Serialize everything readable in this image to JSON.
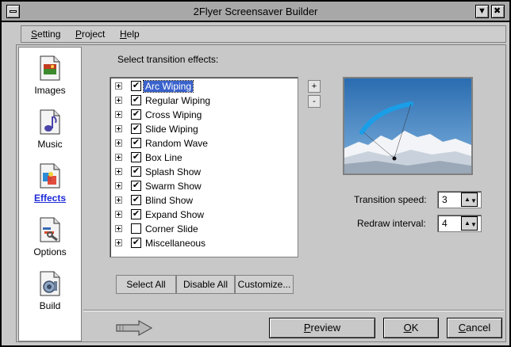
{
  "window": {
    "title": "2Flyer Screensaver Builder"
  },
  "menu": {
    "items": [
      {
        "label": "Setting",
        "accel": "S",
        "rest": "etting"
      },
      {
        "label": "Project",
        "accel": "P",
        "rest": "roject"
      },
      {
        "label": "Help",
        "accel": "H",
        "rest": "elp"
      }
    ]
  },
  "sidebar": {
    "items": [
      {
        "label": "Images",
        "icon": "images-icon",
        "active": false
      },
      {
        "label": "Music",
        "icon": "music-icon",
        "active": false
      },
      {
        "label": "Effects",
        "icon": "effects-icon",
        "active": true
      },
      {
        "label": "Options",
        "icon": "options-icon",
        "active": false
      },
      {
        "label": "Build",
        "icon": "build-icon",
        "active": false
      }
    ]
  },
  "effects": {
    "section_label": "Select transition effects:",
    "items": [
      {
        "label": "Arc Wiping",
        "checked": true,
        "selected": true
      },
      {
        "label": "Regular Wiping",
        "checked": true,
        "selected": false
      },
      {
        "label": "Cross Wiping",
        "checked": true,
        "selected": false
      },
      {
        "label": "Slide Wiping",
        "checked": true,
        "selected": false
      },
      {
        "label": "Random Wave",
        "checked": true,
        "selected": false
      },
      {
        "label": "Box Line",
        "checked": true,
        "selected": false
      },
      {
        "label": "Splash Show",
        "checked": true,
        "selected": false
      },
      {
        "label": "Swarm Show",
        "checked": true,
        "selected": false
      },
      {
        "label": "Blind Show",
        "checked": true,
        "selected": false
      },
      {
        "label": "Expand Show",
        "checked": true,
        "selected": false
      },
      {
        "label": "Corner Slide",
        "checked": false,
        "selected": false
      },
      {
        "label": "Miscellaneous",
        "checked": true,
        "selected": false
      }
    ],
    "plus_label": "+",
    "minus_label": "-",
    "buttons": {
      "select_all": "Select All",
      "disable_all": "Disable All",
      "customize": "Customize..."
    }
  },
  "settings": {
    "transition_speed_label": "Transition speed:",
    "transition_speed_value": "3",
    "redraw_interval_label": "Redraw interval:",
    "redraw_interval_value": "4"
  },
  "footer": {
    "preview": {
      "label": "Preview",
      "accel": "P",
      "rest": "review"
    },
    "ok": {
      "label": "OK",
      "accel": "O",
      "rest": "K"
    },
    "cancel": {
      "label": "Cancel",
      "accel": "C",
      "rest": "ancel"
    }
  },
  "colors": {
    "accent": "#3a62cc",
    "active_link": "#1e2ad6",
    "window_bg": "#c8c8c8",
    "titlebar_bg": "#a8a8a8"
  }
}
